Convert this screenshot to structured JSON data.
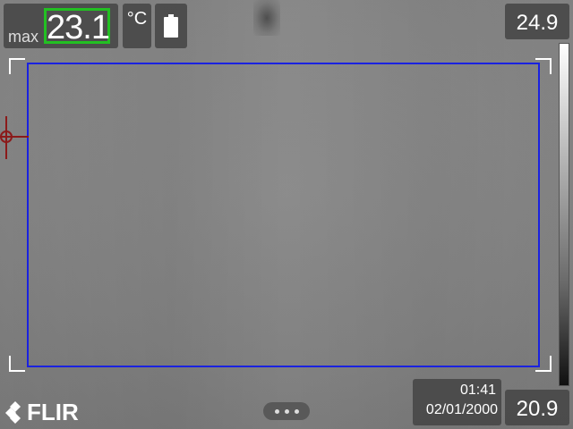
{
  "measurement": {
    "label": "max",
    "value": "23.1"
  },
  "unit": "°C",
  "battery": {
    "icon": "battery-icon"
  },
  "scale": {
    "max": "24.9",
    "min": "20.9"
  },
  "datetime": {
    "time": "01:41",
    "date": "02/01/2000"
  },
  "brand": {
    "name": "FLIR"
  },
  "menu": {
    "icon": "more-dots-icon"
  },
  "colors": {
    "measure_box": "#1a22e0",
    "max_highlight": "#22c022",
    "spot_marker": "#8b1a1a"
  }
}
